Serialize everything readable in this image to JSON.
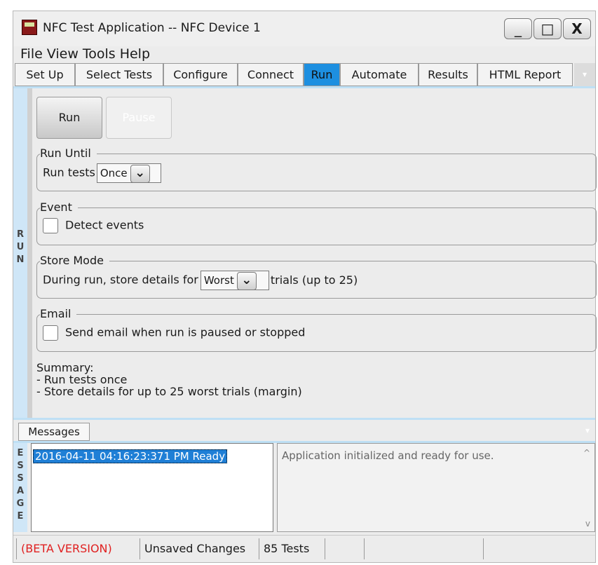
{
  "window": {
    "title": "NFC Test Application -- NFC Device 1",
    "controls": [
      "_",
      "□",
      "X"
    ]
  },
  "menu": [
    "File",
    "View",
    "Tools",
    "Help"
  ],
  "tabs": [
    "Set Up",
    "Select Tests",
    "Configure",
    "Connect",
    "Run",
    "Automate",
    "Results",
    "HTML Report"
  ],
  "active_tab": "Run",
  "run_panel": {
    "side_label": "RUN",
    "run_button": "Run",
    "pause_button": "Pause",
    "run_until": {
      "legend": "Run Until",
      "prefix": "Run tests",
      "value": "Once"
    },
    "event": {
      "legend": "Event",
      "checkbox_label": "Detect events",
      "checked": false
    },
    "store_mode": {
      "legend": "Store Mode",
      "prefix": "During run, store details for",
      "value": "Worst",
      "suffix": "trials (up to 25)"
    },
    "email": {
      "legend": "Email",
      "checkbox_label": "Send email when run is paused or stopped",
      "checked": false
    },
    "summary": {
      "title": "Summary:",
      "lines": [
        "- Run tests once",
        "- Store details for up to 25 worst trials (margin)"
      ]
    }
  },
  "messages": {
    "tab": "Messages",
    "side_label": "ESSAGE",
    "items": [
      "2016-04-11 04:16:23:371 PM Ready"
    ],
    "detail": "Application initialized and ready for use."
  },
  "statusbar": {
    "beta": "(BETA VERSION)",
    "changes": "Unsaved Changes",
    "tests": "85 Tests"
  },
  "colors": {
    "active_tab": "#1d8fe0",
    "selection": "#1f7fd6",
    "beta_text": "#e02020",
    "side_panel": "#cfe6f7"
  }
}
